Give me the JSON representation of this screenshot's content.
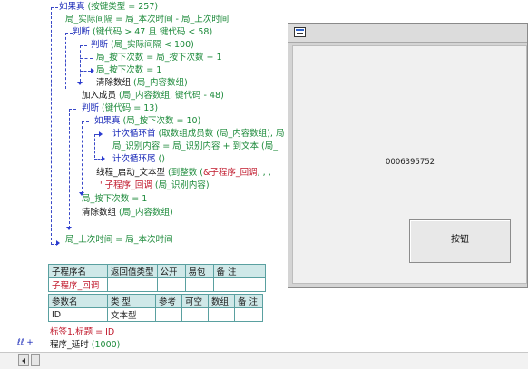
{
  "code": {
    "if_true_257": {
      "keyword": "如果真",
      "rest": " (按键类型 = 257)"
    },
    "assign_interval": "局_实际间隔 = 局_本次时间 - 局_上次时间",
    "judge_keycode": {
      "keyword": "判断",
      "rest": " (键代码 > 47 且 键代码 < 58)"
    },
    "judge_interval": {
      "keyword": "判断",
      "rest": " (局_实际间隔 < 100)"
    },
    "incr_count": "局_按下次数 = 局_按下次数 + 1",
    "reset_count": "局_按下次数 = 1",
    "clear_array": {
      "fn": "清除数组",
      "args": " (局_内容数组)"
    },
    "add_member": {
      "fn": "加入成员",
      "args": " (局_内容数组, 键代码 - 48)"
    },
    "judge_13": {
      "keyword": "判断",
      "rest": " (键代码 = 13)"
    },
    "if_true_10": {
      "keyword": "如果真",
      "rest": " (局_按下次数 = 10)"
    },
    "loop_start": {
      "fn": "计次循环首",
      "args": " (取数组成员数 (局_内容数组), 局"
    },
    "assign_content": {
      "lhs": "局_识别内容 = 局_识别内容 + 到文本",
      "rhs": " (局_"
    },
    "loop_end": {
      "fn": "计次循环尾",
      "args": " ()"
    },
    "thread_start": {
      "fn": "线程_启动_文本型",
      "args": " (到整数 (",
      "sub": "&子程序_回调",
      "tail": ", , , "
    },
    "callback_line": {
      "sub": "' 子程序_回调",
      "args": " (局_识别内容)"
    },
    "set_count_1": "局_按下次数 = 1",
    "clear_array_2": {
      "fn": "清除数组",
      "args": " (局_内容数组)"
    },
    "assign_last_time": "局_上次时间 = 局_本次时间"
  },
  "sub_table": {
    "header": [
      "子程序名",
      "返回值类型",
      "公开",
      "易包",
      "备 注"
    ],
    "row": [
      "子程序_回调",
      "",
      "",
      "",
      ""
    ],
    "param_header": [
      "参数名",
      "类 型",
      "参考",
      "可空",
      "数组",
      "备 注"
    ],
    "param_row": [
      "ID",
      "文本型",
      "",
      "",
      "",
      ""
    ]
  },
  "after_table": {
    "line1": "标签1.标题 = ID",
    "line2_fn": "程序_延时",
    "line2_args": " (1000)",
    "margin_mark": "ℓℓ +"
  },
  "window": {
    "label_text": "0006395752",
    "button_label": "按钮"
  },
  "colors": {
    "keyword_blue": "#1a2ab8",
    "variable_green": "#1c8a3a",
    "sub_red": "#c0182b",
    "table_header_bg": "#cfe8e8"
  }
}
